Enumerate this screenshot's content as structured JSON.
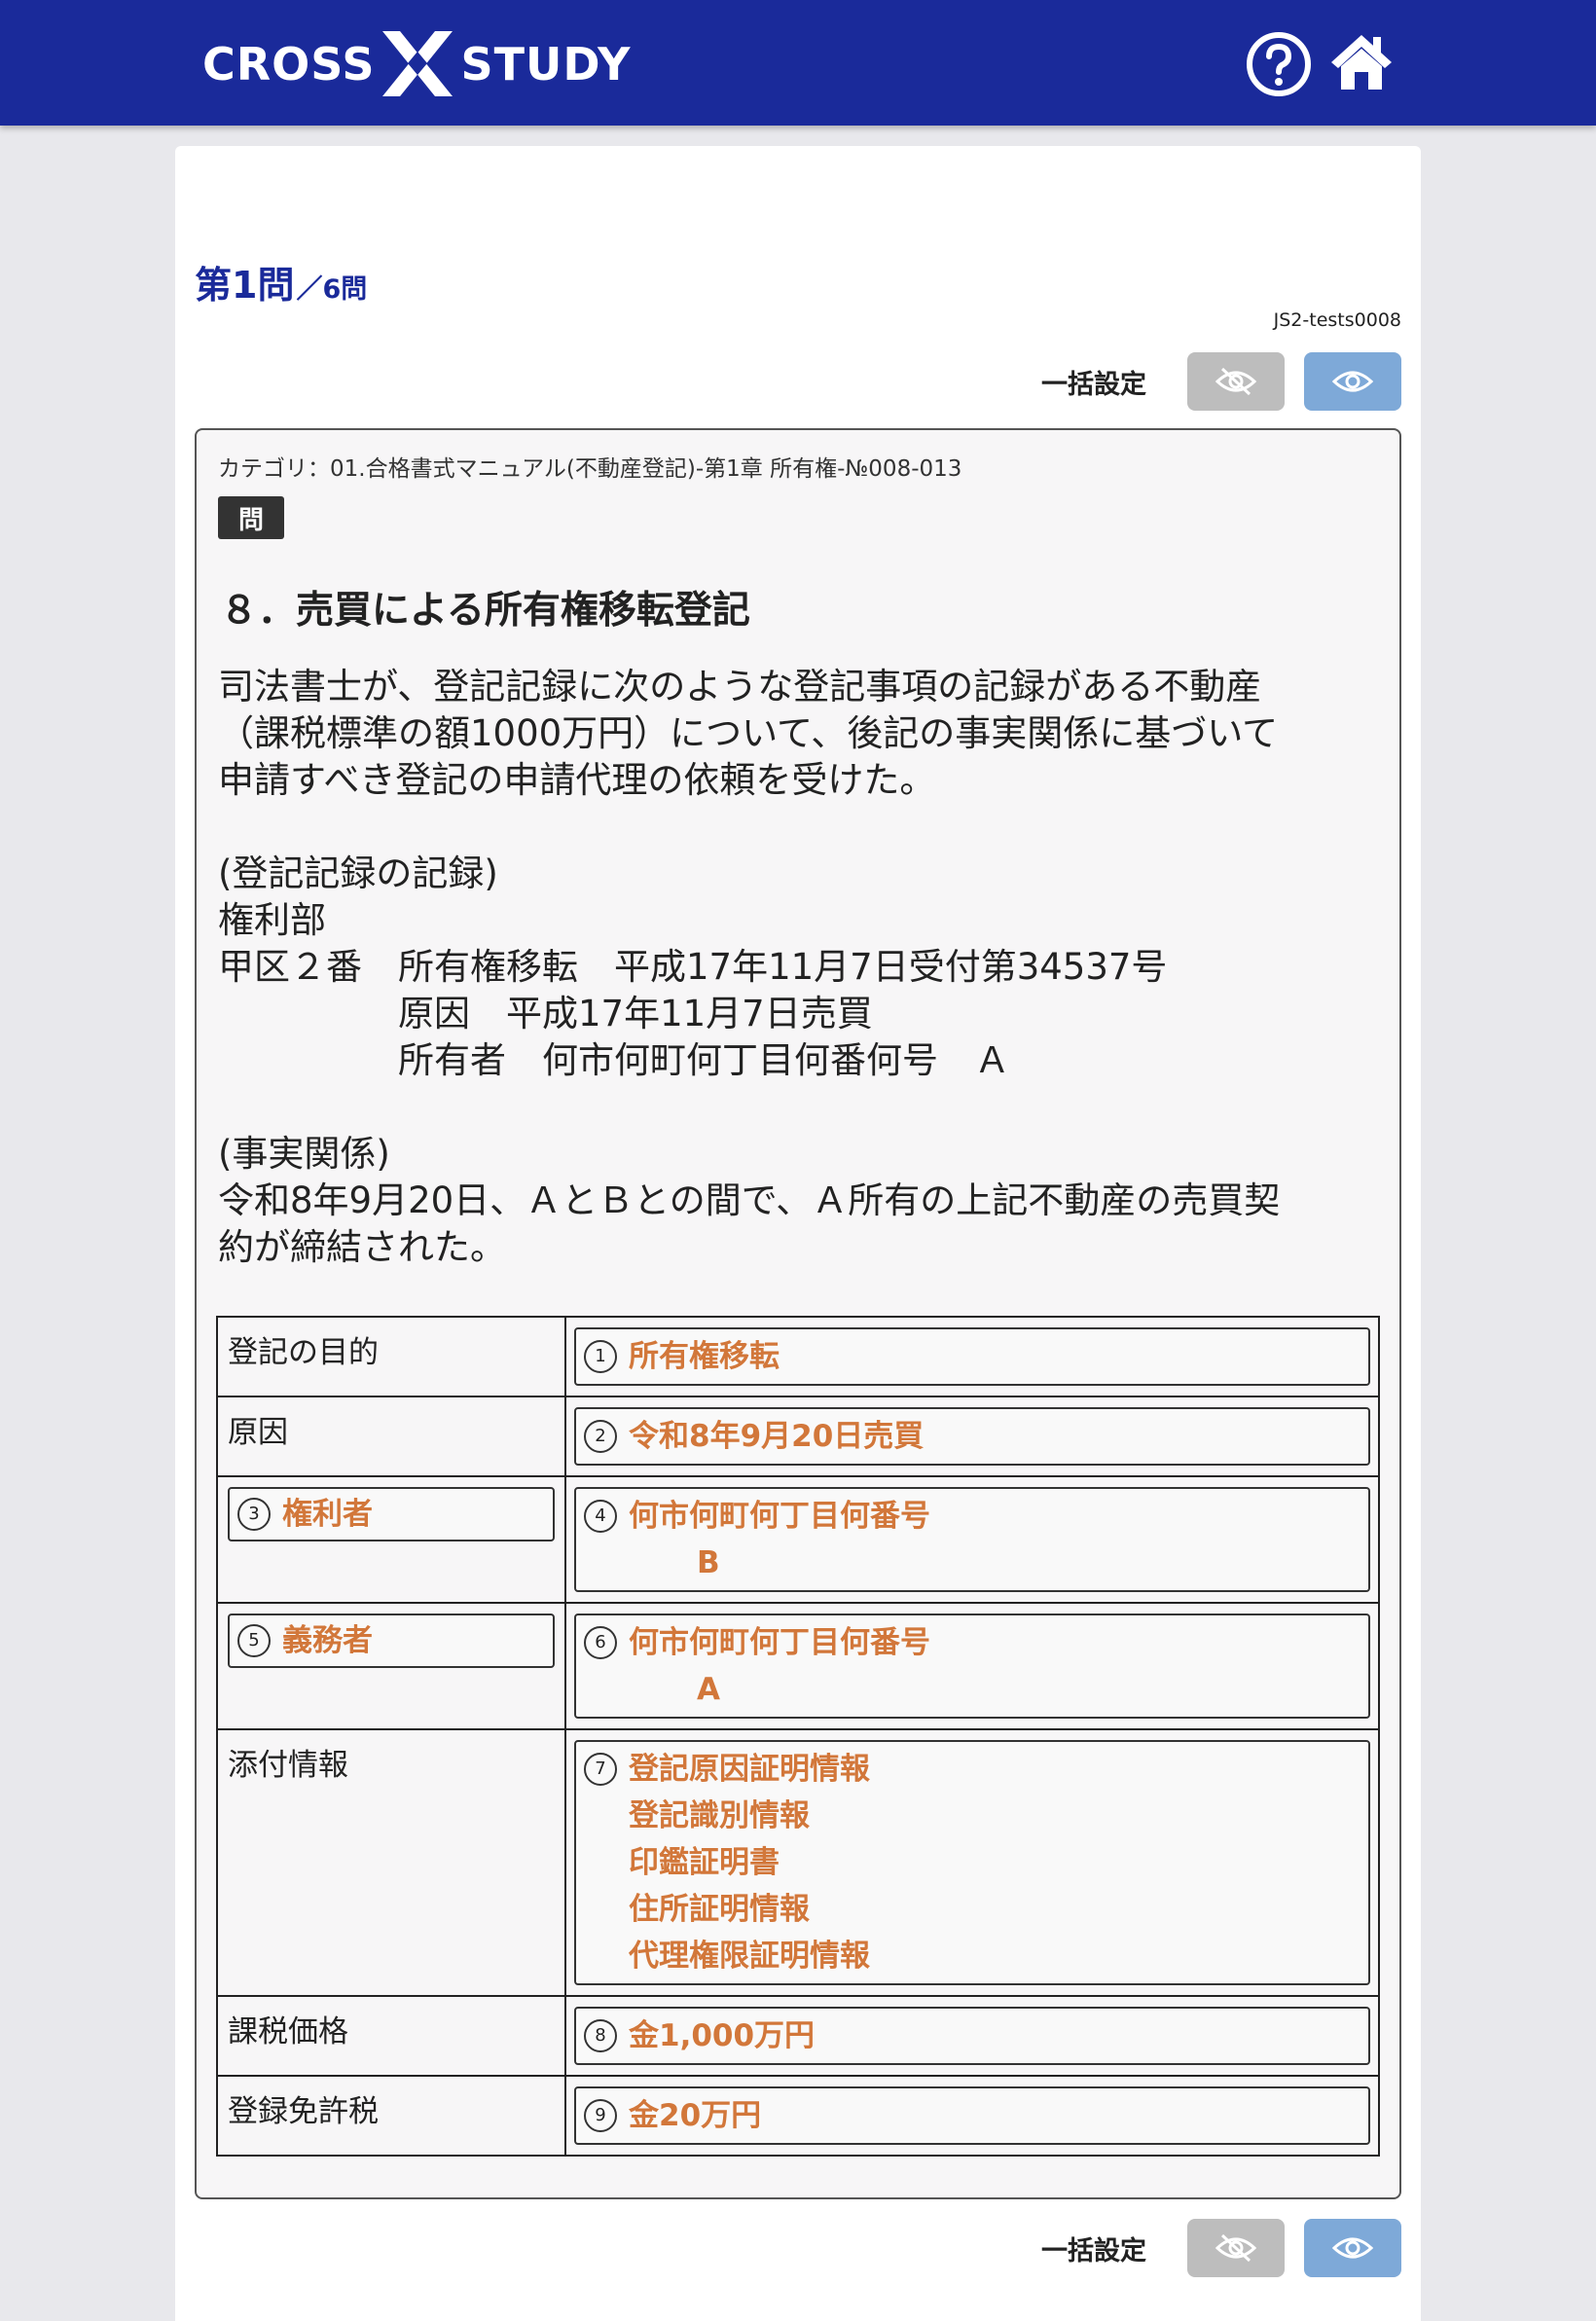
{
  "header": {
    "logo_left": "CROSS",
    "logo_right": "STUDY",
    "help_icon": "help-circle-icon",
    "home_icon": "home-icon",
    "brand_color": "#1a2a9a"
  },
  "question": {
    "number": "第1問",
    "total": "／6問",
    "test_id": "JS2-tests0008",
    "bulk_label": "一括設定",
    "category": "カテゴリ：01.合格書式マニュアル(不動産登記)-第1章 所有権-№008-013",
    "tag": "問",
    "heading": "８．売買による所有権移転登記",
    "body": "司法書士が、登記記録に次のような登記事項の記録がある不動産\n（課税標準の額1000万円）について、後記の事実関係に基づいて\n申請すべき登記の申請代理の依頼を受けた。\n\n(登記記録の記録)\n権利部\n甲区２番　所有権移転　平成17年11月7日受付第34537号\n　　　　　原因　平成17年11月7日売買\n　　　　　所有者　何市何町何丁目何番何号　Ａ\n\n(事実関係)\n令和8年9月20日、ＡとＢとの間で、Ａ所有の上記不動産の売買契\n約が締結された。"
  },
  "answers": {
    "purpose_label": "登記の目的",
    "a1_num": "1",
    "a1": "所有権移転",
    "cause_label": "原因",
    "a2_num": "2",
    "a2": "令和8年9月20日売買",
    "a3_num": "3",
    "a3": "権利者",
    "a4_num": "4",
    "a4_line1": "何市何町何丁目何番号",
    "a4_line2": "B",
    "a5_num": "5",
    "a5": "義務者",
    "a6_num": "6",
    "a6_line1": "何市何町何丁目何番号",
    "a6_line2": "A",
    "attach_label": "添付情報",
    "a7_num": "7",
    "a7_items": [
      "登記原因証明情報",
      "登記識別情報",
      "印鑑証明書",
      "住所証明情報",
      "代理権限証明情報"
    ],
    "tax_base_label": "課税価格",
    "a8_num": "8",
    "a8": "金1,000万円",
    "reg_tax_label": "登録免許税",
    "a9_num": "9",
    "a9": "金20万円",
    "answer_color": "#d2773a"
  },
  "buttons": {
    "hide_all_icon": "eye-slash-icon",
    "show_all_icon": "eye-icon"
  }
}
